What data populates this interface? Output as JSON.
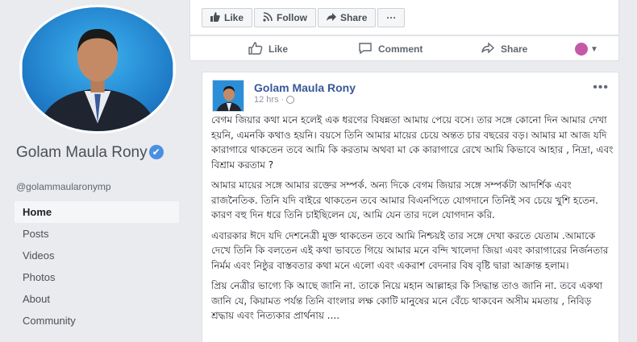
{
  "profile": {
    "name": "Golam Maula Rony",
    "handle": "@golammaularonymp"
  },
  "nav": [
    {
      "label": "Home",
      "active": true
    },
    {
      "label": "Posts",
      "active": false
    },
    {
      "label": "Videos",
      "active": false
    },
    {
      "label": "Photos",
      "active": false
    },
    {
      "label": "About",
      "active": false
    },
    {
      "label": "Community",
      "active": false
    }
  ],
  "page_actions": {
    "like_label": "Like",
    "follow_label": "Follow",
    "share_label": "Share",
    "more_label": "···"
  },
  "prev_post_actions": {
    "like_label": "Like",
    "comment_label": "Comment",
    "share_label": "Share"
  },
  "post": {
    "author": "Golam Maula Rony",
    "time": "12 hrs",
    "more": "•••",
    "paragraphs": [
      "বেগম জিয়ার কথা মনে হলেই এক ধরণের বিষন্নতা আমায় পেয়ে বসে। তার সঙ্গে কোনো দিন আমার দেখা হয়নি, এমনকি কথাও হয়নি। বয়সে তিনি আমার মায়ের চেয়ে অন্তত চার বছরের বড়। আমার মা আজ যদি কারাগারে থাকতেন তবে আমি কি করতাম অথবা মা কে কারাগারে রেখে আমি কিভাবে আহার , নিদ্রা, এবং বিশ্রাম করতাম ?",
      "আমার মায়ের সঙ্গে আমার রক্তের সম্পর্ক. অন্য দিকে বেগম জিয়ার সঙ্গে সম্পর্কটা আদর্শিক এবং রাজনৈতিক. তিনি যদি বাইরে থাকতেন তবে আমার বিএনপিতে যোগদানে তিনিই সব চেয়ে খুশি হতেন. কারণ বহু দিন ধরে তিনি চাইছিলেন যে, আমি যেন তার দলে যোগদান করি.",
      "এবারকার ঈদে যদি দেশনেত্রী মুক্ত থাকতেন তবে আমি নিশ্চয়ই তার সঙ্গে দেখা করতে যেতাম .আমাকে দেখে তিনি কি বলতেন এই কথা ভাবতে গিয়ে আমার মনে বন্দি খালেদা জিয়া এবং কারাগারের নির্জনতার নির্মম এবং নিষ্ঠুর বাস্তবতার কথা মনে এলো এবং একরাশ বেদনার বিষ বৃষ্টি দ্বারা আক্রান্ত হলাম।",
      "প্রিয় নেত্রীর ভাগ্যে কি আছে জানি না. তাকে নিয়ে মহান আল্লাহর কি সিদ্ধান্ত তাও জানি না. তবে একথা জানি যে, কিয়ামত পর্যন্ত তিনি বাংলার লক্ষ কোটি মানুষের মনে বেঁচে থাকবেন অসীম মমতায় , নিবিড় শ্রদ্ধায় এবং নিত্যকার প্রার্থনায় ...."
    ]
  }
}
